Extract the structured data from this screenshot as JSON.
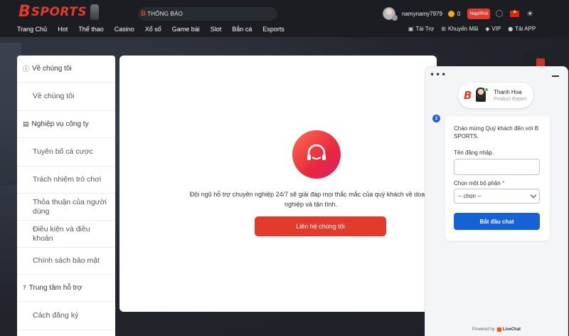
{
  "header": {
    "logo_letter": "B",
    "logo_text": "SPORTS",
    "notice_letter": "B",
    "notice_text": "THÔNG BÁO",
    "username": "namynamy7979",
    "balance": "0",
    "deposit_label": "Nạp/Rút",
    "nav": [
      "Trang Chủ",
      "Hot",
      "Thể thao",
      "Casino",
      "Xổ số",
      "Game bài",
      "Slot",
      "Bắn cá",
      "Esports"
    ],
    "right_nav": [
      {
        "icon": "sponsor-icon",
        "label": "Tài Trợ"
      },
      {
        "icon": "gift-icon",
        "label": "Khuyến Mãi"
      },
      {
        "icon": "diamond-icon",
        "label": "VIP"
      },
      {
        "icon": "download-icon",
        "label": "Tải APP"
      }
    ]
  },
  "sidemenu": {
    "sections": [
      {
        "title": "Về chúng tôi",
        "icon": "info-icon",
        "items": [
          "Về chúng tôi"
        ]
      },
      {
        "title": "Nghiệp vụ công ty",
        "icon": "briefcase-icon",
        "items": [
          "Tuyên bố cá cược",
          "Trách nhiệm trò chơi",
          "Thỏa thuận của người dùng",
          "Điều kiện và điều khoản",
          "Chính sách bảo mật"
        ]
      },
      {
        "title": "Trung tâm hỗ trợ",
        "icon": "help-icon",
        "items": [
          "Cách đăng ký"
        ]
      }
    ]
  },
  "panel": {
    "description": "Đội ngũ hỗ trợ chuyên nghiệp 24/7 sẽ giải đáp mọi thắc mắc của quý khách về doanh nghiệp và tận tình.",
    "contact_label": "Liên hệ chúng tôi"
  },
  "chat": {
    "agent_name": "Thanh Hoa",
    "agent_role": "Product Expert",
    "badge": "2",
    "welcome": "Chào mừng Quý khách đến với B SPORTS.",
    "username_label": "Tên đăng nhập.",
    "username_value": "",
    "dept_label": "Chọn một bộ phận",
    "dept_required": "*",
    "dept_selected": "-- chọn --",
    "start_label": "Bắt đầu chat",
    "powered_by": "Powered by",
    "powered_brand": "LiveChat"
  },
  "colors": {
    "brand_red": "#e23a2b",
    "chat_blue": "#1462d6",
    "header_bg": "#1b1d22"
  }
}
